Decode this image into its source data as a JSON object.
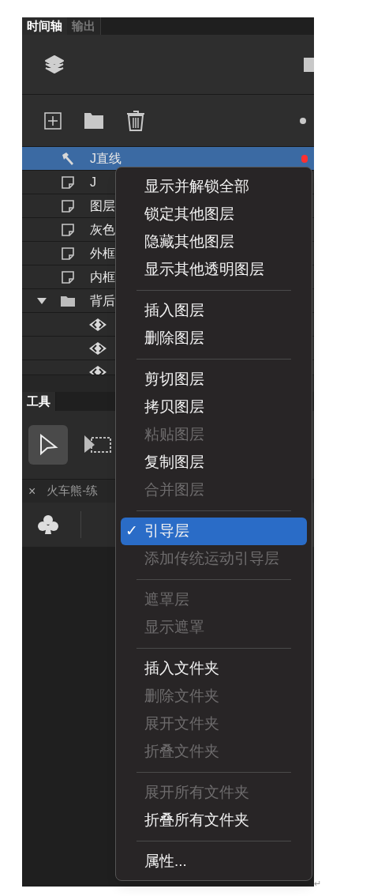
{
  "panel_tabs": [
    {
      "label": "时间轴",
      "selected": true
    },
    {
      "label": "输出",
      "selected": false
    }
  ],
  "layers": [
    {
      "kind": "guide",
      "name": "J直线",
      "selected": true,
      "marked": true
    },
    {
      "kind": "layer",
      "name": "J",
      "selected": false
    },
    {
      "kind": "layer",
      "name": "图层",
      "selected": false
    },
    {
      "kind": "layer",
      "name": "灰色",
      "selected": false
    },
    {
      "kind": "layer",
      "name": "外框",
      "selected": false
    },
    {
      "kind": "layer",
      "name": "内框",
      "selected": false
    },
    {
      "kind": "folder",
      "name": "背后",
      "selected": false,
      "expanded": true,
      "children": [
        {
          "kind": "symbol",
          "selected": false
        },
        {
          "kind": "symbol",
          "selected": false
        },
        {
          "kind": "symbol",
          "selected": false
        }
      ]
    }
  ],
  "tools_tab": {
    "label": "工具"
  },
  "document_tab": {
    "close": "×",
    "title": "火车熊-练"
  },
  "context_menu": [
    {
      "kind": "item",
      "label": "显示并解锁全部",
      "disabled": false,
      "checked": false,
      "selected": false
    },
    {
      "kind": "item",
      "label": "锁定其他图层",
      "disabled": false,
      "checked": false,
      "selected": false
    },
    {
      "kind": "item",
      "label": "隐藏其他图层",
      "disabled": false,
      "checked": false,
      "selected": false
    },
    {
      "kind": "item",
      "label": "显示其他透明图层",
      "disabled": false,
      "checked": false,
      "selected": false
    },
    {
      "kind": "separator"
    },
    {
      "kind": "item",
      "label": "插入图层",
      "disabled": false,
      "checked": false,
      "selected": false
    },
    {
      "kind": "item",
      "label": "删除图层",
      "disabled": false,
      "checked": false,
      "selected": false
    },
    {
      "kind": "separator"
    },
    {
      "kind": "item",
      "label": "剪切图层",
      "disabled": false,
      "checked": false,
      "selected": false
    },
    {
      "kind": "item",
      "label": "拷贝图层",
      "disabled": false,
      "checked": false,
      "selected": false
    },
    {
      "kind": "item",
      "label": "粘贴图层",
      "disabled": true,
      "checked": false,
      "selected": false
    },
    {
      "kind": "item",
      "label": "复制图层",
      "disabled": false,
      "checked": false,
      "selected": false
    },
    {
      "kind": "item",
      "label": "合并图层",
      "disabled": true,
      "checked": false,
      "selected": false
    },
    {
      "kind": "separator"
    },
    {
      "kind": "item",
      "label": "引导层",
      "disabled": false,
      "checked": true,
      "selected": true
    },
    {
      "kind": "item",
      "label": "添加传统运动引导层",
      "disabled": true,
      "checked": false,
      "selected": false
    },
    {
      "kind": "separator"
    },
    {
      "kind": "item",
      "label": "遮罩层",
      "disabled": true,
      "checked": false,
      "selected": false
    },
    {
      "kind": "item",
      "label": "显示遮罩",
      "disabled": true,
      "checked": false,
      "selected": false
    },
    {
      "kind": "separator"
    },
    {
      "kind": "item",
      "label": "插入文件夹",
      "disabled": false,
      "checked": false,
      "selected": false
    },
    {
      "kind": "item",
      "label": "删除文件夹",
      "disabled": true,
      "checked": false,
      "selected": false
    },
    {
      "kind": "item",
      "label": "展开文件夹",
      "disabled": true,
      "checked": false,
      "selected": false
    },
    {
      "kind": "item",
      "label": "折叠文件夹",
      "disabled": true,
      "checked": false,
      "selected": false
    },
    {
      "kind": "separator"
    },
    {
      "kind": "item",
      "label": "展开所有文件夹",
      "disabled": true,
      "checked": false,
      "selected": false
    },
    {
      "kind": "item",
      "label": "折叠所有文件夹",
      "disabled": false,
      "checked": false,
      "selected": false
    },
    {
      "kind": "separator"
    },
    {
      "kind": "item",
      "label": "属性...",
      "disabled": false,
      "checked": false,
      "selected": false
    }
  ],
  "check_mark": "✓",
  "page_mark": "↵"
}
